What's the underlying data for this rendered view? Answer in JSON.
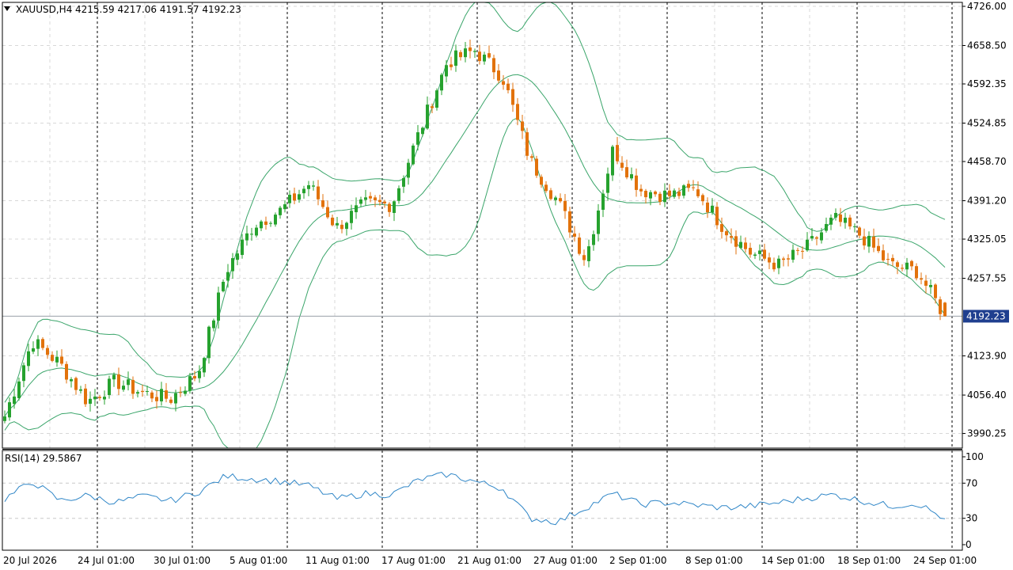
{
  "header": {
    "symbol_timeframe": "XAUUSD,H4",
    "ohlc": "4215.59 4217.06 4191.57 4192.23"
  },
  "indicator": {
    "label": "RSI(14) 29.5867",
    "levels": [
      100,
      70,
      30,
      0
    ]
  },
  "price_axis": {
    "ticks": [
      "4726.00",
      "4658.50",
      "4592.35",
      "4524.85",
      "4458.70",
      "4391.20",
      "4325.05",
      "4257.55",
      "4123.90",
      "4056.40",
      "3990.25"
    ],
    "current_price_label": "4192.23"
  },
  "time_axis": {
    "labels": [
      "20 Jul 2026",
      "24 Jul 01:00",
      "30 Jul 01:00",
      "5 Aug 01:00",
      "11 Aug 01:00",
      "17 Aug 01:00",
      "21 Aug 01:00",
      "27 Aug 01:00",
      "2 Sep 01:00",
      "8 Sep 01:00",
      "14 Sep 01:00",
      "18 Sep 01:00",
      "24 Sep 01:00"
    ]
  },
  "colors": {
    "bull_candle": "#26a22e",
    "bear_candle": "#e2720b",
    "bands": "#3aa56a",
    "rsi_line": "#2f86c7",
    "grid": "#d8d8d8",
    "price_label_bg": "#1f3f8f"
  },
  "chart_data": {
    "type": "candlestick",
    "price_series_name": "XAUUSD,H4",
    "timeframe": "H4",
    "ylim": [
      3960,
      4726
    ],
    "grid": true,
    "current_price": 4192.23,
    "last_bar": {
      "open": 4215.59,
      "high": 4217.06,
      "low": 4191.57,
      "close": 4192.23
    },
    "bollinger_bands": "overlay (upper, middle, lower)",
    "rsi_series_name": "RSI(14)",
    "rsi_ylim": [
      0,
      100
    ],
    "rsi_last": 29.5867,
    "close_trajectory": [
      {
        "date": "20 Jul 2026",
        "close": 4020
      },
      {
        "date": "22 Jul",
        "close": 4150
      },
      {
        "date": "24 Jul 01:00",
        "close": 4110
      },
      {
        "date": "26 Jul",
        "close": 4045
      },
      {
        "date": "28 Jul",
        "close": 4080
      },
      {
        "date": "30 Jul 01:00",
        "close": 4060
      },
      {
        "date": "1 Aug",
        "close": 4050
      },
      {
        "date": "3 Aug",
        "close": 4095
      },
      {
        "date": "5 Aug 01:00",
        "close": 4270
      },
      {
        "date": "7 Aug",
        "close": 4350
      },
      {
        "date": "9 Aug",
        "close": 4375
      },
      {
        "date": "11 Aug 01:00",
        "close": 4420
      },
      {
        "date": "13 Aug",
        "close": 4345
      },
      {
        "date": "15 Aug",
        "close": 4385
      },
      {
        "date": "17 Aug 01:00",
        "close": 4385
      },
      {
        "date": "19 Aug",
        "close": 4510
      },
      {
        "date": "21 Aug 01:00",
        "close": 4630
      },
      {
        "date": "23 Aug",
        "close": 4650
      },
      {
        "date": "25 Aug",
        "close": 4605
      },
      {
        "date": "27 Aug 01:00",
        "close": 4460
      },
      {
        "date": "29 Aug",
        "close": 4390
      },
      {
        "date": "31 Aug",
        "close": 4290
      },
      {
        "date": "2 Sep 01:00",
        "close": 4480
      },
      {
        "date": "4 Sep",
        "close": 4410
      },
      {
        "date": "6 Sep",
        "close": 4400
      },
      {
        "date": "8 Sep 01:00",
        "close": 4410
      },
      {
        "date": "10 Sep",
        "close": 4345
      },
      {
        "date": "12 Sep",
        "close": 4300
      },
      {
        "date": "14 Sep 01:00",
        "close": 4280
      },
      {
        "date": "16 Sep",
        "close": 4310
      },
      {
        "date": "18 Sep 01:00",
        "close": 4360
      },
      {
        "date": "20 Sep",
        "close": 4330
      },
      {
        "date": "22 Sep",
        "close": 4280
      },
      {
        "date": "24 Sep 01:00",
        "close": 4270
      },
      {
        "date": "24 Sep",
        "close": 4192.23
      }
    ],
    "rsi_trajectory": [
      52,
      72,
      50,
      56,
      48,
      55,
      50,
      60,
      78,
      75,
      72,
      67,
      52,
      58,
      57,
      74,
      80,
      72,
      64,
      30,
      26,
      42,
      58,
      46,
      48,
      45,
      42,
      44,
      48,
      53,
      57,
      50,
      44,
      47,
      29.5867
    ]
  }
}
